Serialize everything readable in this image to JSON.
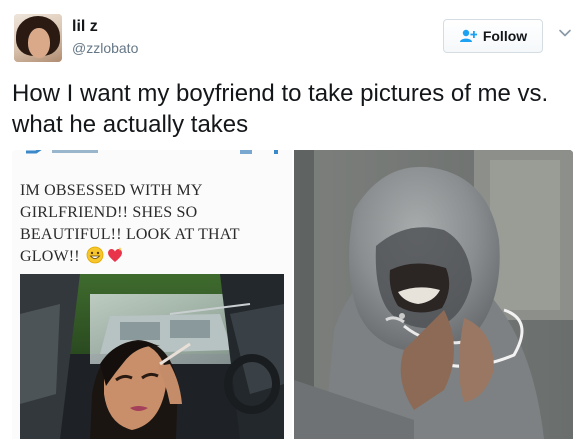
{
  "user": {
    "display_name": "lil z",
    "handle": "@zzlobato"
  },
  "follow_button": {
    "label": "Follow",
    "accent": "#1da1f2"
  },
  "tweet": {
    "text": "How I want my boyfriend to take pictures of me vs. what he actually takes"
  },
  "media": {
    "left_caption": "IM OBSESSED WITH MY GIRLFRIEND!! SHES SO BEAUTIFUL!! LOOK AT THAT GLOW!!",
    "left_caption_emoji": [
      "smiley-face-emoji",
      "sparkling-heart-emoji"
    ]
  },
  "icons": {
    "follow": "add-user-icon",
    "more": "chevron-down-icon"
  }
}
